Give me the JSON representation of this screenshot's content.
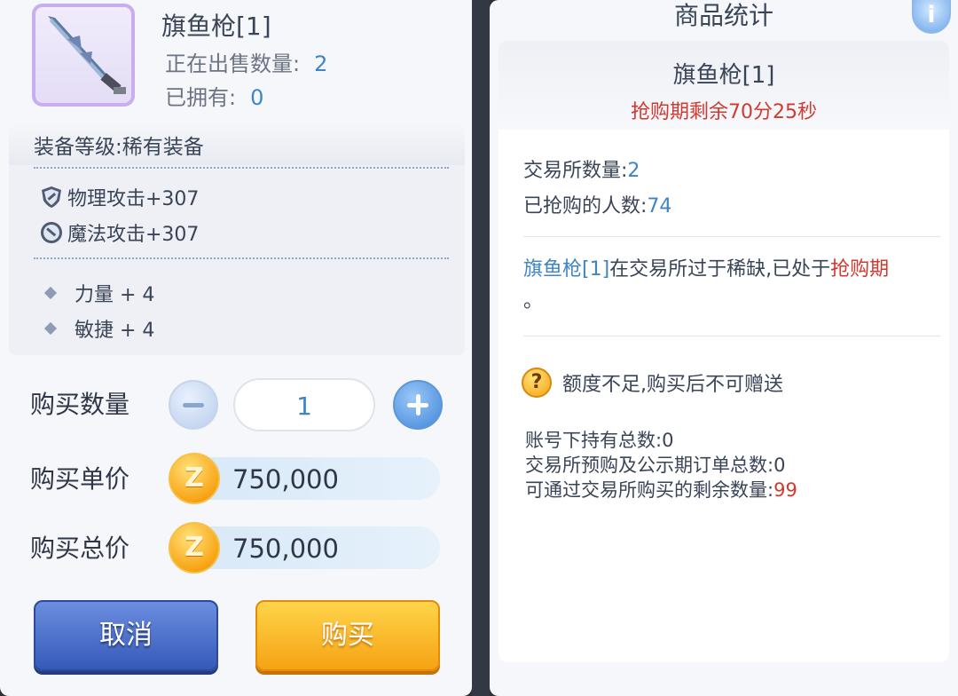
{
  "item": {
    "name": "旗鱼枪[1]",
    "selling_label": "正在出售数量:",
    "selling_count": "2",
    "owned_label": "已拥有:",
    "owned_count": "0"
  },
  "details": {
    "grade": "装备等级:稀有装备",
    "attributes": [
      {
        "icon": "physical-shield-icon",
        "text": "物理攻击+307"
      },
      {
        "icon": "magic-shield-icon",
        "text": "魔法攻击+307"
      }
    ],
    "bonuses": [
      "力量 + 4",
      "敏捷 + 4"
    ]
  },
  "purchase": {
    "qty_label": "购买数量",
    "qty_value": "1",
    "unit_price_label": "购买单价",
    "unit_price": "750,000",
    "total_price_label": "购买总价",
    "total_price": "750,000",
    "coin_symbol": "Z",
    "cancel_label": "取消",
    "buy_label": "购买"
  },
  "stats": {
    "title": "商品统计",
    "info_icon": "i",
    "item_name": "旗鱼枪[1]",
    "timer": "抢购期剩余70分25秒",
    "exchange_qty_label": "交易所数量:",
    "exchange_qty": "2",
    "buyers_label": "已抢购的人数:",
    "buyers": "74",
    "note_item": "旗鱼枪[1]",
    "note_mid": "在交易所过于稀缺,已处于",
    "note_period": "抢购期",
    "note_end": "。",
    "warn_icon": "?",
    "warning": "额度不足,购买后不可赠送",
    "held_label": "账号下持有总数:",
    "held": "0",
    "orders_label": "交易所预购及公示期订单总数:",
    "orders": "0",
    "remaining_label": "可通过交易所购买的剩余数量:",
    "remaining": "99"
  },
  "colors": {
    "accent_blue": "#3d85c6",
    "alert_red": "#d03a2f",
    "buy_orange": "#f5a313",
    "cancel_blue": "#3559b8"
  }
}
